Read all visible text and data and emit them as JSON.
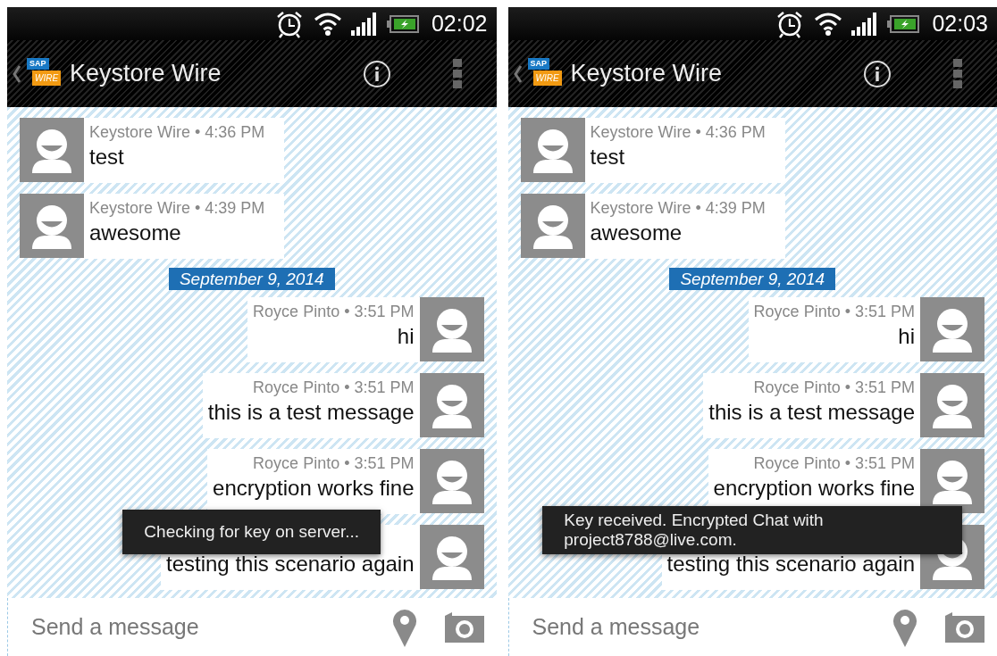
{
  "screens": [
    {
      "status_bar": {
        "time": "02:02"
      },
      "action_bar": {
        "logo": {
          "top": "SAP",
          "bottom": "WIRE"
        },
        "title": "Keystore Wire"
      },
      "messages": [
        {
          "kind": "incoming",
          "meta": "Keystore Wire • 4:36 PM",
          "text": "test"
        },
        {
          "kind": "incoming",
          "meta": "Keystore Wire • 4:39 PM",
          "text": "awesome"
        },
        {
          "kind": "date",
          "text": "September 9, 2014"
        },
        {
          "kind": "outgoing",
          "meta": "Royce Pinto • 3:51 PM",
          "text": "hi"
        },
        {
          "kind": "outgoing",
          "meta": "Royce Pinto • 3:51 PM",
          "text": "this is a test message"
        },
        {
          "kind": "outgoing",
          "meta": "Royce Pinto • 3:51 PM",
          "text": "encryption works fine"
        },
        {
          "kind": "outgoing",
          "text": "testing this scenario again"
        }
      ],
      "toast": {
        "text": "Checking for key on server..."
      },
      "composer": {
        "placeholder": "Send a message"
      }
    },
    {
      "status_bar": {
        "time": "02:03"
      },
      "action_bar": {
        "logo": {
          "top": "SAP",
          "bottom": "WIRE"
        },
        "title": "Keystore Wire"
      },
      "messages": [
        {
          "kind": "incoming",
          "meta": "Keystore Wire • 4:36 PM",
          "text": "test"
        },
        {
          "kind": "incoming",
          "meta": "Keystore Wire • 4:39 PM",
          "text": "awesome"
        },
        {
          "kind": "date",
          "text": "September 9, 2014"
        },
        {
          "kind": "outgoing",
          "meta": "Royce Pinto • 3:51 PM",
          "text": "hi"
        },
        {
          "kind": "outgoing",
          "meta": "Royce Pinto • 3:51 PM",
          "text": "this is a test message"
        },
        {
          "kind": "outgoing",
          "meta": "Royce Pinto • 3:51 PM",
          "text": "encryption works fine"
        },
        {
          "kind": "outgoing",
          "text": "testing this scenario again"
        }
      ],
      "toast": {
        "text": "Key received. Encrypted Chat with project8788@live.com."
      },
      "composer": {
        "placeholder": "Send a message"
      }
    }
  ]
}
